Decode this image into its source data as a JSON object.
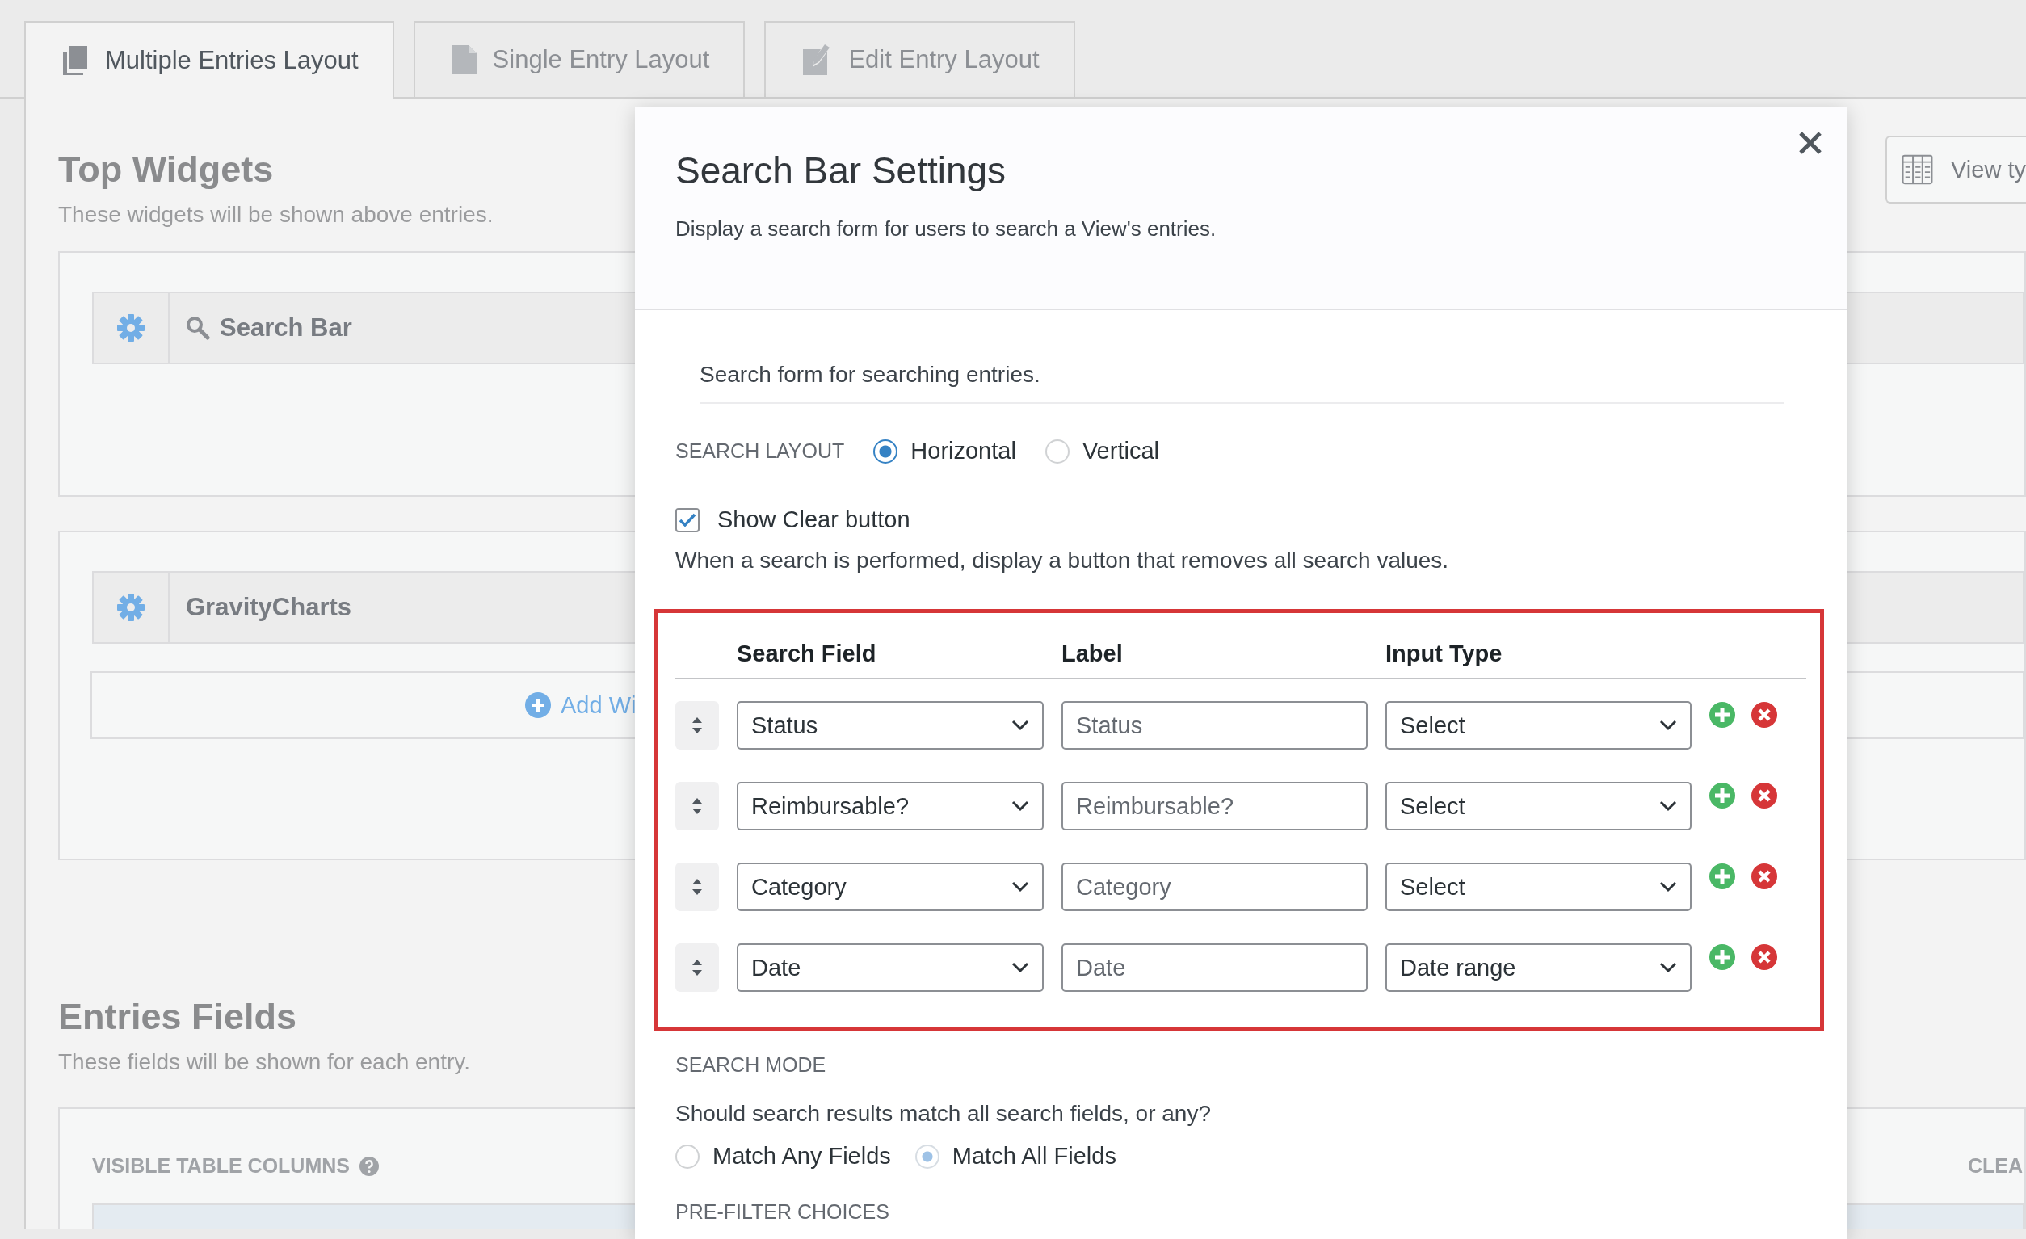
{
  "tabs": [
    {
      "label": "Multiple Entries Layout",
      "kind": "pages",
      "selected": true
    },
    {
      "label": "Single Entry Layout",
      "kind": "page",
      "selected": false
    },
    {
      "label": "Edit Entry Layout",
      "kind": "edit",
      "selected": false
    }
  ],
  "top_widgets": {
    "title": "Top Widgets",
    "subtitle": "These widgets will be shown above entries.",
    "view_type_button": "View ty",
    "areas": [
      {
        "widgets": [
          {
            "label": "Search Bar",
            "kind": "search"
          }
        ]
      },
      {
        "widgets": [
          {
            "label": "GravityCharts",
            "kind": "plain"
          }
        ],
        "add_button": "Add Wi"
      }
    ]
  },
  "entries_fields": {
    "title": "Entries Fields",
    "subtitle": "These fields will be shown for each entry.",
    "section_label": "VISIBLE TABLE COLUMNS",
    "clear_link": "CLEA"
  },
  "modal": {
    "title": "Search Bar Settings",
    "description": "Display a search form for users to search a View's entries.",
    "intro": "Search form for searching entries.",
    "search_layout": {
      "label": "SEARCH LAYOUT",
      "options": [
        {
          "label": "Horizontal",
          "selected": true
        },
        {
          "label": "Vertical",
          "selected": false
        }
      ]
    },
    "show_clear": {
      "label": "Show Clear button",
      "checked": true,
      "description": "When a search is performed, display a button that removes all search values."
    },
    "fields_table": {
      "columns": [
        "Search Field",
        "Label",
        "Input Type"
      ],
      "rows": [
        {
          "search_field": "Status",
          "label_placeholder": "Status",
          "input_type": "Select"
        },
        {
          "search_field": "Reimbursable?",
          "label_placeholder": "Reimbursable?",
          "input_type": "Select"
        },
        {
          "search_field": "Category",
          "label_placeholder": "Category",
          "input_type": "Select"
        },
        {
          "search_field": "Date",
          "label_placeholder": "Date",
          "input_type": "Date range"
        }
      ]
    },
    "search_mode": {
      "label": "SEARCH MODE",
      "question": "Should search results match all search fields, or any?",
      "options": [
        {
          "label": "Match Any Fields",
          "selected": false
        },
        {
          "label": "Match All Fields",
          "selected": true
        }
      ]
    },
    "pre_filter": {
      "label": "PRE-FILTER CHOICES"
    }
  }
}
